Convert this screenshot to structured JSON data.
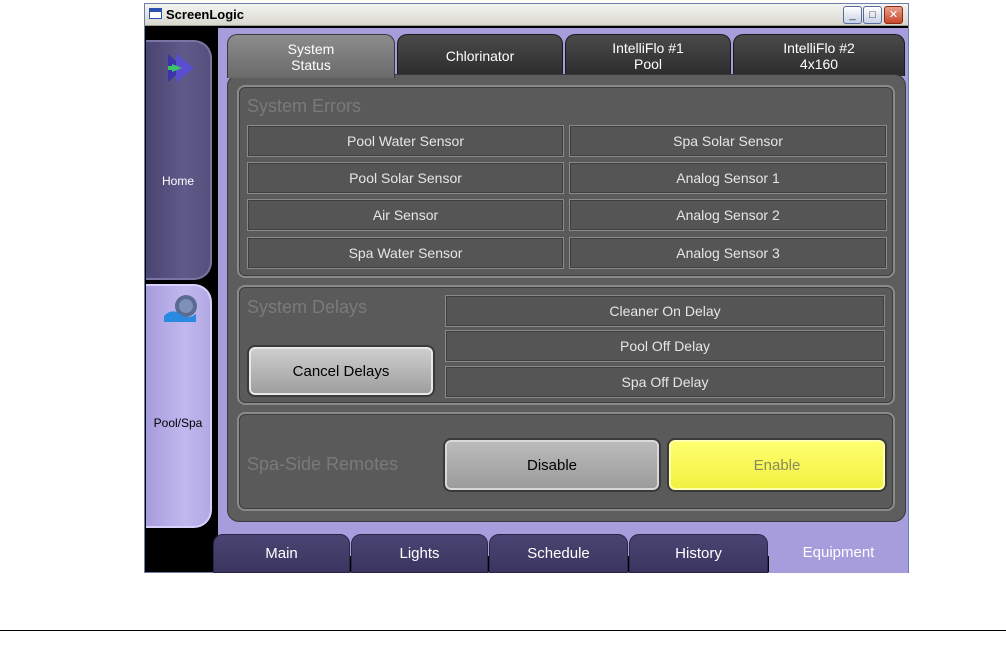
{
  "window": {
    "title": "ScreenLogic",
    "minimize": "_",
    "maximize": "□",
    "close": "✕"
  },
  "sidebar": {
    "home_label": "Home",
    "pool_label": "Pool/Spa"
  },
  "top_tabs": [
    {
      "label": "System\nStatus",
      "active": true
    },
    {
      "label": "Chlorinator",
      "active": false
    },
    {
      "label": "IntelliFlo #1\nPool",
      "active": false
    },
    {
      "label": "IntelliFlo #2\n4x160",
      "active": false
    }
  ],
  "system_errors": {
    "title": "System Errors",
    "left": [
      "Pool Water Sensor",
      "Pool Solar Sensor",
      "Air Sensor",
      "Spa Water Sensor"
    ],
    "right": [
      "Spa Solar Sensor",
      "Analog Sensor 1",
      "Analog Sensor 2",
      "Analog Sensor 3"
    ]
  },
  "system_delays": {
    "title": "System Delays",
    "cancel_label": "Cancel Delays",
    "items": [
      "Cleaner On Delay",
      "Pool Off Delay",
      "Spa Off Delay"
    ]
  },
  "spa_remotes": {
    "title": "Spa-Side Remotes",
    "disable_label": "Disable",
    "enable_label": "Enable",
    "enabled": true
  },
  "bottom_tabs": [
    {
      "label": "Main",
      "active": false
    },
    {
      "label": "Lights",
      "active": false
    },
    {
      "label": "Schedule",
      "active": false
    },
    {
      "label": "History",
      "active": false
    },
    {
      "label": "Equipment",
      "active": true
    }
  ],
  "colors": {
    "accent_purple": "#a79cdc",
    "dark_purple": "#4a4472",
    "enable_yellow": "#ffff70"
  }
}
